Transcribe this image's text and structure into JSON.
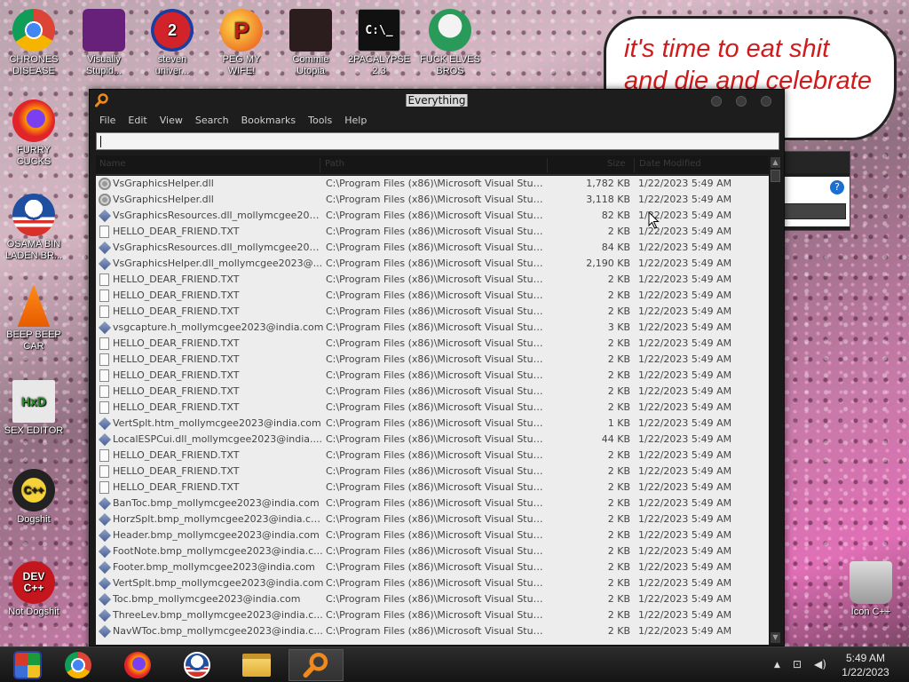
{
  "desktop": {
    "icons": [
      {
        "label": "CHRONES\nDISEASE",
        "glyph": ""
      },
      {
        "label": "Visually\nStupid...",
        "glyph": ""
      },
      {
        "label": "steven\nuniver...",
        "glyph": "2"
      },
      {
        "label": "PEG MY WIFE!",
        "glyph": "P"
      },
      {
        "label": "Commie\nUtopia",
        "glyph": ""
      },
      {
        "label": "2PACALYPSE\n2.3",
        "glyph": "C:\\_"
      },
      {
        "label": "FUCK ELVES\nBROS",
        "glyph": ""
      },
      {
        "label": "FURRY CUCKS",
        "glyph": ""
      },
      {
        "label": "OSAMA BIN\nLADEN BR...",
        "glyph": ""
      },
      {
        "label": "BEEP BEEP\nCAR",
        "glyph": ""
      },
      {
        "label": "SEX EDITOR",
        "glyph": "HxD"
      },
      {
        "label": "Dogshit",
        "glyph": "C++"
      },
      {
        "label": "Not Dogshit",
        "glyph": "DEV\nC++"
      },
      {
        "label": "Icon C++",
        "glyph": ""
      }
    ],
    "speech_bubble": {
      "line1": "it's time to eat shit",
      "line2": "and die and celebrate"
    }
  },
  "window": {
    "title": "Everything",
    "menu": [
      "File",
      "Edit",
      "View",
      "Search",
      "Bookmarks",
      "Tools",
      "Help"
    ],
    "search_value": "",
    "columns": {
      "name": "Name",
      "path": "Path",
      "size": "Size",
      "date": "Date Modified"
    },
    "rows": [
      {
        "icon": "dll",
        "name": "VsGraphicsHelper.dll",
        "path": "C:\\Program Files (x86)\\Microsoft Visual Stud...",
        "size": "1,782 KB",
        "date": "1/22/2023 5:49 AM"
      },
      {
        "icon": "dll",
        "name": "VsGraphicsHelper.dll",
        "path": "C:\\Program Files (x86)\\Microsoft Visual Stud...",
        "size": "3,118 KB",
        "date": "1/22/2023 5:49 AM"
      },
      {
        "icon": "diamond",
        "name": "VsGraphicsResources.dll_mollymcgee202...",
        "path": "C:\\Program Files (x86)\\Microsoft Visual Stud...",
        "size": "82 KB",
        "date": "1/22/2023 5:49 AM"
      },
      {
        "icon": "txt",
        "name": "HELLO_DEAR_FRIEND.TXT",
        "path": "C:\\Program Files (x86)\\Microsoft Visual Stud...",
        "size": "2 KB",
        "date": "1/22/2023 5:49 AM"
      },
      {
        "icon": "diamond",
        "name": "VsGraphicsResources.dll_mollymcgee202...",
        "path": "C:\\Program Files (x86)\\Microsoft Visual Stud...",
        "size": "84 KB",
        "date": "1/22/2023 5:49 AM"
      },
      {
        "icon": "diamond",
        "name": "VsGraphicsHelper.dll_mollymcgee2023@...",
        "path": "C:\\Program Files (x86)\\Microsoft Visual Stud...",
        "size": "2,190 KB",
        "date": "1/22/2023 5:49 AM"
      },
      {
        "icon": "txt",
        "name": "HELLO_DEAR_FRIEND.TXT",
        "path": "C:\\Program Files (x86)\\Microsoft Visual Stud...",
        "size": "2 KB",
        "date": "1/22/2023 5:49 AM"
      },
      {
        "icon": "txt",
        "name": "HELLO_DEAR_FRIEND.TXT",
        "path": "C:\\Program Files (x86)\\Microsoft Visual Stud...",
        "size": "2 KB",
        "date": "1/22/2023 5:49 AM"
      },
      {
        "icon": "txt",
        "name": "HELLO_DEAR_FRIEND.TXT",
        "path": "C:\\Program Files (x86)\\Microsoft Visual Stud...",
        "size": "2 KB",
        "date": "1/22/2023 5:49 AM"
      },
      {
        "icon": "diamond",
        "name": "vsgcapture.h_mollymcgee2023@india.com",
        "path": "C:\\Program Files (x86)\\Microsoft Visual Stud...",
        "size": "3 KB",
        "date": "1/22/2023 5:49 AM"
      },
      {
        "icon": "txt",
        "name": "HELLO_DEAR_FRIEND.TXT",
        "path": "C:\\Program Files (x86)\\Microsoft Visual Stud...",
        "size": "2 KB",
        "date": "1/22/2023 5:49 AM"
      },
      {
        "icon": "txt",
        "name": "HELLO_DEAR_FRIEND.TXT",
        "path": "C:\\Program Files (x86)\\Microsoft Visual Stud...",
        "size": "2 KB",
        "date": "1/22/2023 5:49 AM"
      },
      {
        "icon": "txt",
        "name": "HELLO_DEAR_FRIEND.TXT",
        "path": "C:\\Program Files (x86)\\Microsoft Visual Stud...",
        "size": "2 KB",
        "date": "1/22/2023 5:49 AM"
      },
      {
        "icon": "txt",
        "name": "HELLO_DEAR_FRIEND.TXT",
        "path": "C:\\Program Files (x86)\\Microsoft Visual Stud...",
        "size": "2 KB",
        "date": "1/22/2023 5:49 AM"
      },
      {
        "icon": "txt",
        "name": "HELLO_DEAR_FRIEND.TXT",
        "path": "C:\\Program Files (x86)\\Microsoft Visual Stud...",
        "size": "2 KB",
        "date": "1/22/2023 5:49 AM"
      },
      {
        "icon": "diamond",
        "name": "VertSplt.htm_mollymcgee2023@india.com",
        "path": "C:\\Program Files (x86)\\Microsoft Visual Stud...",
        "size": "1 KB",
        "date": "1/22/2023 5:49 AM"
      },
      {
        "icon": "diamond",
        "name": "LocalESPCui.dll_mollymcgee2023@india....",
        "path": "C:\\Program Files (x86)\\Microsoft Visual Stud...",
        "size": "44 KB",
        "date": "1/22/2023 5:49 AM"
      },
      {
        "icon": "txt",
        "name": "HELLO_DEAR_FRIEND.TXT",
        "path": "C:\\Program Files (x86)\\Microsoft Visual Stud...",
        "size": "2 KB",
        "date": "1/22/2023 5:49 AM"
      },
      {
        "icon": "txt",
        "name": "HELLO_DEAR_FRIEND.TXT",
        "path": "C:\\Program Files (x86)\\Microsoft Visual Stud...",
        "size": "2 KB",
        "date": "1/22/2023 5:49 AM"
      },
      {
        "icon": "txt",
        "name": "HELLO_DEAR_FRIEND.TXT",
        "path": "C:\\Program Files (x86)\\Microsoft Visual Stud...",
        "size": "2 KB",
        "date": "1/22/2023 5:49 AM"
      },
      {
        "icon": "diamond",
        "name": "BanToc.bmp_mollymcgee2023@india.com",
        "path": "C:\\Program Files (x86)\\Microsoft Visual Stud...",
        "size": "2 KB",
        "date": "1/22/2023 5:49 AM"
      },
      {
        "icon": "diamond",
        "name": "HorzSplt.bmp_mollymcgee2023@india.com",
        "path": "C:\\Program Files (x86)\\Microsoft Visual Stud...",
        "size": "2 KB",
        "date": "1/22/2023 5:49 AM"
      },
      {
        "icon": "diamond",
        "name": "Header.bmp_mollymcgee2023@india.com",
        "path": "C:\\Program Files (x86)\\Microsoft Visual Stud...",
        "size": "2 KB",
        "date": "1/22/2023 5:49 AM"
      },
      {
        "icon": "diamond",
        "name": "FootNote.bmp_mollymcgee2023@india.c...",
        "path": "C:\\Program Files (x86)\\Microsoft Visual Stud...",
        "size": "2 KB",
        "date": "1/22/2023 5:49 AM"
      },
      {
        "icon": "diamond",
        "name": "Footer.bmp_mollymcgee2023@india.com",
        "path": "C:\\Program Files (x86)\\Microsoft Visual Stud...",
        "size": "2 KB",
        "date": "1/22/2023 5:49 AM"
      },
      {
        "icon": "diamond",
        "name": "VertSplt.bmp_mollymcgee2023@india.com",
        "path": "C:\\Program Files (x86)\\Microsoft Visual Stud...",
        "size": "2 KB",
        "date": "1/22/2023 5:49 AM"
      },
      {
        "icon": "diamond",
        "name": "Toc.bmp_mollymcgee2023@india.com",
        "path": "C:\\Program Files (x86)\\Microsoft Visual Stud...",
        "size": "2 KB",
        "date": "1/22/2023 5:49 AM"
      },
      {
        "icon": "diamond",
        "name": "ThreeLev.bmp_mollymcgee2023@india.c...",
        "path": "C:\\Program Files (x86)\\Microsoft Visual Stud...",
        "size": "2 KB",
        "date": "1/22/2023 5:49 AM"
      },
      {
        "icon": "diamond",
        "name": "NavWToc.bmp_mollymcgee2023@india.c...",
        "path": "C:\\Program Files (x86)\\Microsoft Visual Stud...",
        "size": "2 KB",
        "date": "1/22/2023 5:49 AM"
      }
    ]
  },
  "taskbar": {
    "clock_time": "5:49 AM",
    "clock_date": "1/22/2023",
    "tray_arrow": "▲",
    "apps": [
      "chrome-icon",
      "firefox-icon",
      "obama-icon",
      "file-explorer-icon",
      "everything-search-icon"
    ]
  }
}
